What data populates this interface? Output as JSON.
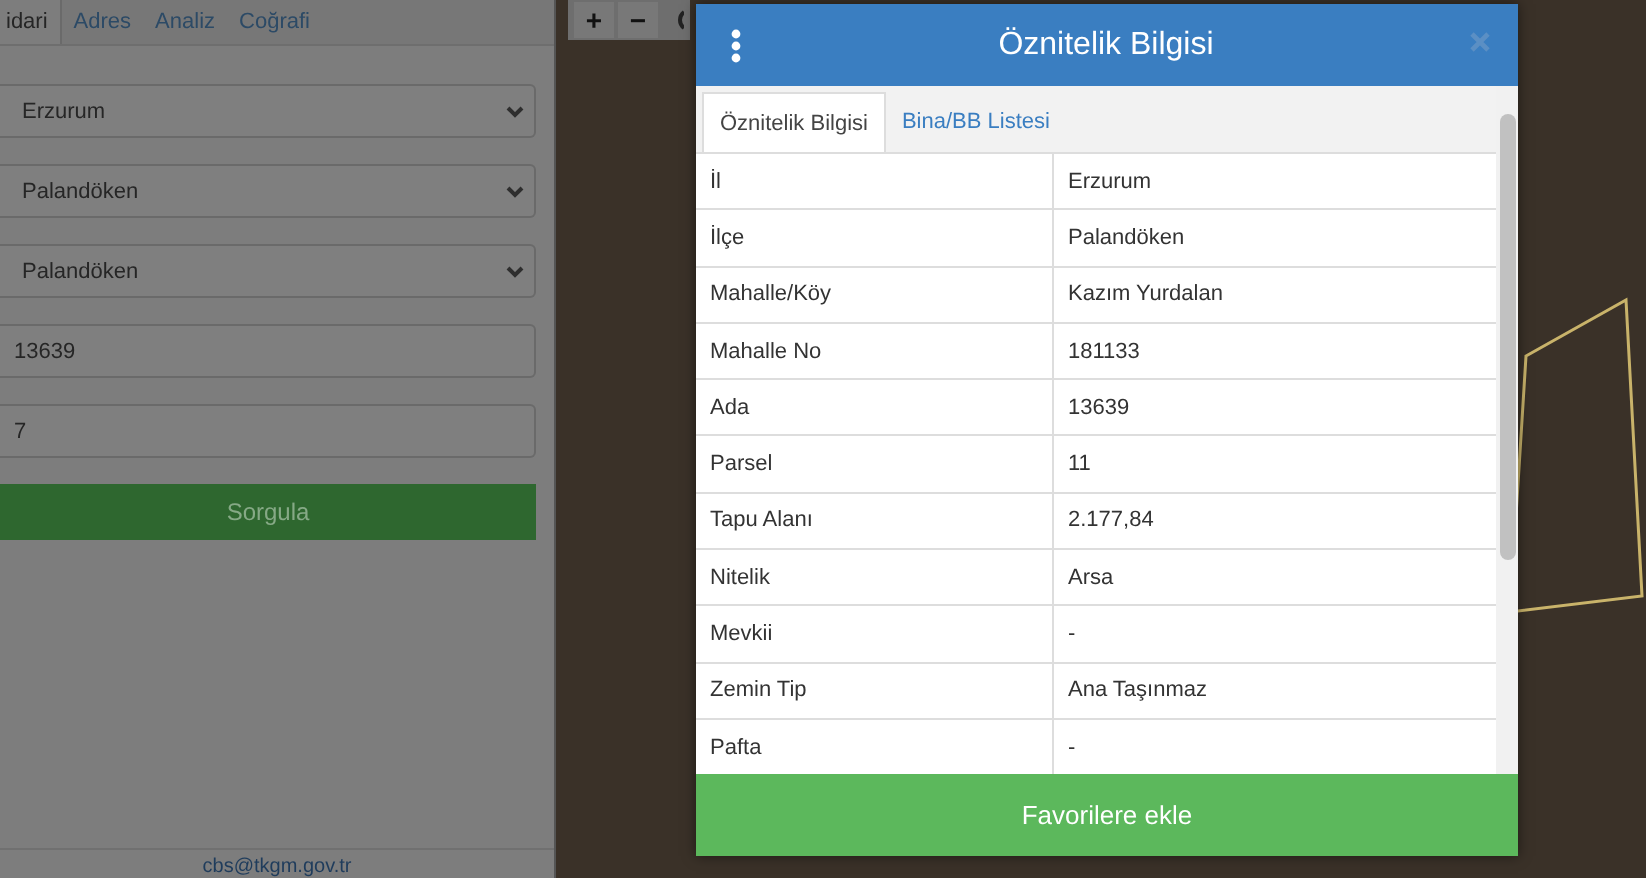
{
  "side_panel": {
    "tabs": [
      {
        "label": "idari",
        "selected": true
      },
      {
        "label": "Adres",
        "selected": false
      },
      {
        "label": "Analiz",
        "selected": false
      },
      {
        "label": "Coğrafi",
        "selected": false
      }
    ],
    "fields": [
      {
        "kind": "select",
        "value": "Erzurum"
      },
      {
        "kind": "select",
        "value": "Palandöken"
      },
      {
        "kind": "select",
        "value": "Palandöken"
      },
      {
        "kind": "input",
        "value": "13639"
      },
      {
        "kind": "input",
        "value": "7"
      }
    ],
    "query_button": "Sorgula",
    "footer_email": "cbs@tkgm.gov.tr"
  },
  "map": {
    "zoom_in": "+",
    "zoom_out": "−"
  },
  "dialog": {
    "title": "Öznitelik Bilgisi",
    "tabs": [
      {
        "label": "Öznitelik Bilgisi",
        "selected": true
      },
      {
        "label": "Bina/BB Listesi",
        "selected": false
      }
    ],
    "rows": [
      {
        "label": "İl",
        "value": "Erzurum"
      },
      {
        "label": "İlçe",
        "value": "Palandöken"
      },
      {
        "label": "Mahalle/Köy",
        "value": "Kazım Yurdalan"
      },
      {
        "label": "Mahalle No",
        "value": "181133"
      },
      {
        "label": "Ada",
        "value": "13639"
      },
      {
        "label": "Parsel",
        "value": "11"
      },
      {
        "label": "Tapu Alanı",
        "value": "2.177,84"
      },
      {
        "label": "Nitelik",
        "value": "Arsa"
      },
      {
        "label": "Mevkii",
        "value": "-"
      },
      {
        "label": "Zemin Tip",
        "value": "Ana Taşınmaz"
      },
      {
        "label": "Pafta",
        "value": "-"
      }
    ],
    "footer_button": "Favorilere ekle"
  }
}
